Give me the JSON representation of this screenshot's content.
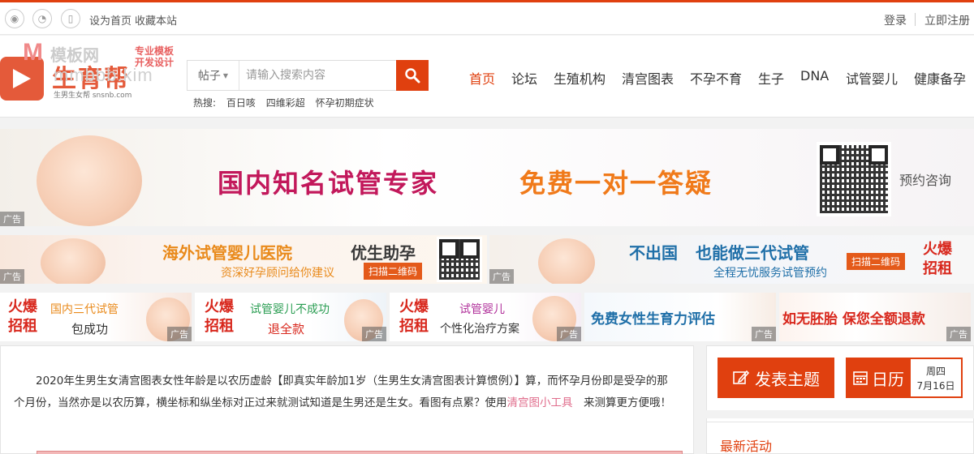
{
  "topbar": {
    "set_home": "设为首页",
    "bookmark": "收藏本站",
    "login": "登录",
    "register": "立即注册"
  },
  "logo": {
    "watermark_m": "M",
    "watermark_cn": "模板网",
    "brand": "生育帮",
    "watermark_url": "mmbbb.kim",
    "tag1": "专业模板",
    "tag2": "开发设计",
    "slogan": "生男生女帮 snsnb.com"
  },
  "search": {
    "type": "帖子",
    "placeholder": "请输入搜索内容",
    "hot_label": "热搜:",
    "hot_terms": [
      "百日咳",
      "四维彩超",
      "怀孕初期症状"
    ]
  },
  "nav": [
    "首页",
    "论坛",
    "生殖机构",
    "清宫图表",
    "不孕不育",
    "生子",
    "DNA",
    "试管婴儿",
    "健康备孕"
  ],
  "ads": {
    "ad_label": "广告",
    "b1": {
      "left": "国内知名试管专家",
      "right": "免费一对一答疑",
      "consult": "预约咨询"
    },
    "b2": {
      "t1": "海外试管婴儿医院",
      "t1b": "优生助孕",
      "t2": "资深好孕顾问给你建议",
      "scan": "扫描二维码"
    },
    "b3": {
      "t1": "不出国",
      "t1b": "也能做三代试管",
      "t2": "全程无忧服务试管预约",
      "scan": "扫描二维码",
      "hot": "火爆",
      "rent": "招租"
    },
    "small": [
      {
        "hot": "火爆",
        "rent": "招租",
        "a": "国内三代试管",
        "b": "包成功"
      },
      {
        "hot": "火爆",
        "rent": "招租",
        "a": "试管婴儿不成功",
        "b": "退全款"
      },
      {
        "hot": "火爆",
        "rent": "招租",
        "a": "试管婴儿",
        "b": "个性化治疗方案"
      },
      {
        "a": "免费女性生育力评估"
      },
      {
        "a": "如无胚胎 保您全额退款"
      }
    ]
  },
  "article": {
    "text_before": "2020年生男生女清宫图表女性年龄是以农历虚龄【即真实年龄加1岁（生男生女清宫图表计算惯例）】算，而怀孕月份即是受孕的那个月份，当然亦是以农历算，横坐标和纵坐标对正过来就测试知道是生男还是生女。看图有点累？使用",
    "link": "清宫图小工具",
    "text_after": "　来测算更方便哦！"
  },
  "sidebar": {
    "post_label": "发表主题",
    "calendar_label": "日历",
    "weekday": "周四",
    "date": "7月16日",
    "latest_title": "最新活动"
  },
  "colors": {
    "brand": "#e0400f",
    "link": "#e06d8c"
  }
}
